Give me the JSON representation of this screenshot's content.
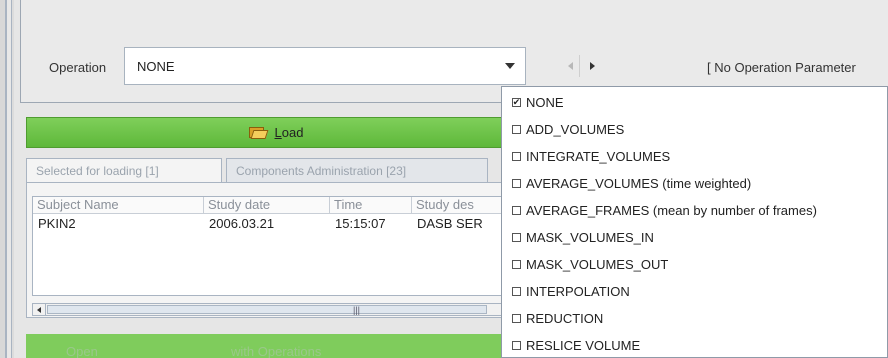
{
  "operation": {
    "label": "Operation",
    "selected": "NONE",
    "parameters_text": "[ No Operation Parameter"
  },
  "load_button": {
    "label_underlined": "L",
    "label_rest": "oad"
  },
  "tabs": [
    {
      "label": "Selected for loading [1]"
    },
    {
      "label": "Components Administration [23]"
    }
  ],
  "table": {
    "columns": [
      "Subject Name",
      "Study date",
      "Time",
      "Study des"
    ],
    "rows": [
      [
        "PKIN2",
        "2006.03.21",
        "15:15:07",
        "DASB SER"
      ]
    ]
  },
  "bottom_toolbar": {
    "items": [
      "Open",
      "with Operations"
    ]
  },
  "dropdown": {
    "items": [
      {
        "label": "NONE",
        "checked": true
      },
      {
        "label": "ADD_VOLUMES",
        "checked": false
      },
      {
        "label": "INTEGRATE_VOLUMES",
        "checked": false
      },
      {
        "label": "AVERAGE_VOLUMES (time weighted)",
        "checked": false
      },
      {
        "label": "AVERAGE_FRAMES (mean by number of frames)",
        "checked": false
      },
      {
        "label": "MASK_VOLUMES_IN",
        "checked": false
      },
      {
        "label": "MASK_VOLUMES_OUT",
        "checked": false
      },
      {
        "label": "INTERPOLATION",
        "checked": false
      },
      {
        "label": "REDUCTION",
        "checked": false
      },
      {
        "label": "RESLICE VOLUME",
        "checked": false
      }
    ]
  }
}
